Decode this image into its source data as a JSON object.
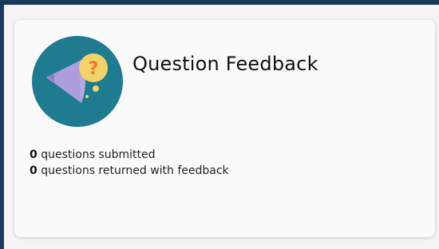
{
  "card": {
    "title": "Question Feedback",
    "logo_icon": "fish-question-bubble-icon",
    "stats": [
      {
        "value": "0",
        "label": "questions submitted"
      },
      {
        "value": "0",
        "label": "questions returned with feedback"
      }
    ]
  },
  "colors": {
    "page_border": "#1a3a5c",
    "logo_circle": "#1f7b8f",
    "fish": "#b7a6e3",
    "bubble": "#f2d36a",
    "question_mark": "#f07a2b"
  }
}
